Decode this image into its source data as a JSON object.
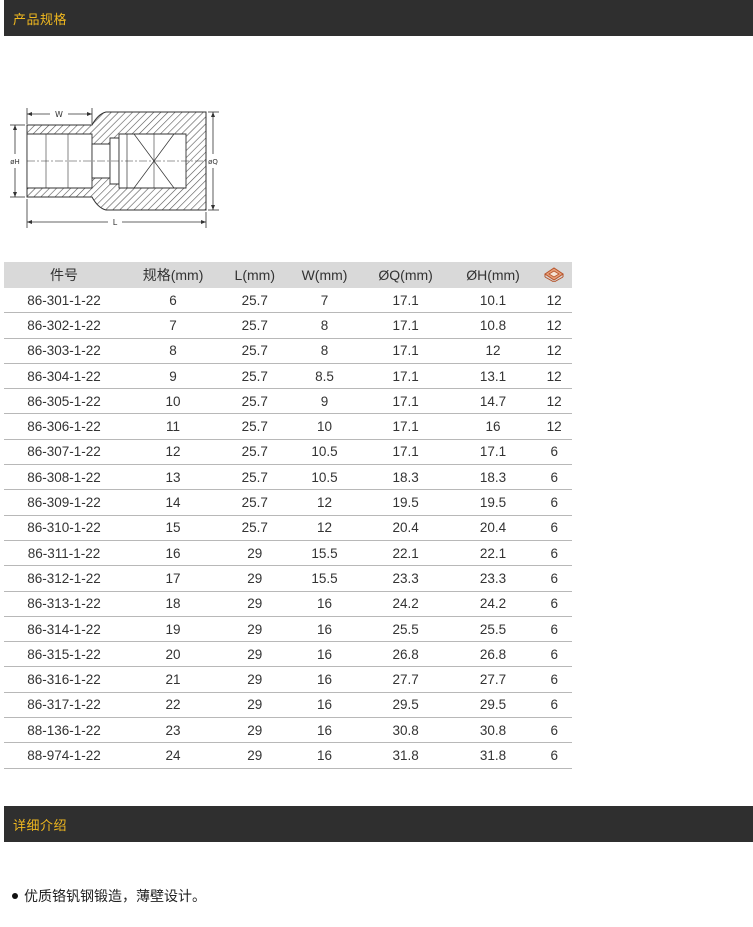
{
  "section1": {
    "title": "产品规格"
  },
  "diagram": {
    "label_w": "W",
    "label_l": "L",
    "label_h": "øH",
    "label_q": "øQ"
  },
  "table": {
    "headers": [
      "件号",
      "规格(mm)",
      "L(mm)",
      "W(mm)",
      "ØQ(mm)",
      "ØH(mm)"
    ],
    "icon": "socket-points-icon",
    "rows": [
      [
        "86-301-1-22",
        "6",
        "25.7",
        "7",
        "17.1",
        "10.1",
        "12"
      ],
      [
        "86-302-1-22",
        "7",
        "25.7",
        "8",
        "17.1",
        "10.8",
        "12"
      ],
      [
        "86-303-1-22",
        "8",
        "25.7",
        "8",
        "17.1",
        "12",
        "12"
      ],
      [
        "86-304-1-22",
        "9",
        "25.7",
        "8.5",
        "17.1",
        "13.1",
        "12"
      ],
      [
        "86-305-1-22",
        "10",
        "25.7",
        "9",
        "17.1",
        "14.7",
        "12"
      ],
      [
        "86-306-1-22",
        "11",
        "25.7",
        "10",
        "17.1",
        "16",
        "12"
      ],
      [
        "86-307-1-22",
        "12",
        "25.7",
        "10.5",
        "17.1",
        "17.1",
        "6"
      ],
      [
        "86-308-1-22",
        "13",
        "25.7",
        "10.5",
        "18.3",
        "18.3",
        "6"
      ],
      [
        "86-309-1-22",
        "14",
        "25.7",
        "12",
        "19.5",
        "19.5",
        "6"
      ],
      [
        "86-310-1-22",
        "15",
        "25.7",
        "12",
        "20.4",
        "20.4",
        "6"
      ],
      [
        "86-311-1-22",
        "16",
        "29",
        "15.5",
        "22.1",
        "22.1",
        "6"
      ],
      [
        "86-312-1-22",
        "17",
        "29",
        "15.5",
        "23.3",
        "23.3",
        "6"
      ],
      [
        "86-313-1-22",
        "18",
        "29",
        "16",
        "24.2",
        "24.2",
        "6"
      ],
      [
        "86-314-1-22",
        "19",
        "29",
        "16",
        "25.5",
        "25.5",
        "6"
      ],
      [
        "86-315-1-22",
        "20",
        "29",
        "16",
        "26.8",
        "26.8",
        "6"
      ],
      [
        "86-316-1-22",
        "21",
        "29",
        "16",
        "27.7",
        "27.7",
        "6"
      ],
      [
        "86-317-1-22",
        "22",
        "29",
        "16",
        "29.5",
        "29.5",
        "6"
      ],
      [
        "88-136-1-22",
        "23",
        "29",
        "16",
        "30.8",
        "30.8",
        "6"
      ],
      [
        "88-974-1-22",
        "24",
        "29",
        "16",
        "31.8",
        "31.8",
        "6"
      ]
    ]
  },
  "section2": {
    "title": "详细介绍"
  },
  "intro": {
    "text": "优质铬钒钢锻造，薄壁设计。"
  },
  "colors": {
    "bar_bg": "#2f2f2f",
    "bar_text": "#f0b81f",
    "header_bg": "#d9d9d9"
  }
}
